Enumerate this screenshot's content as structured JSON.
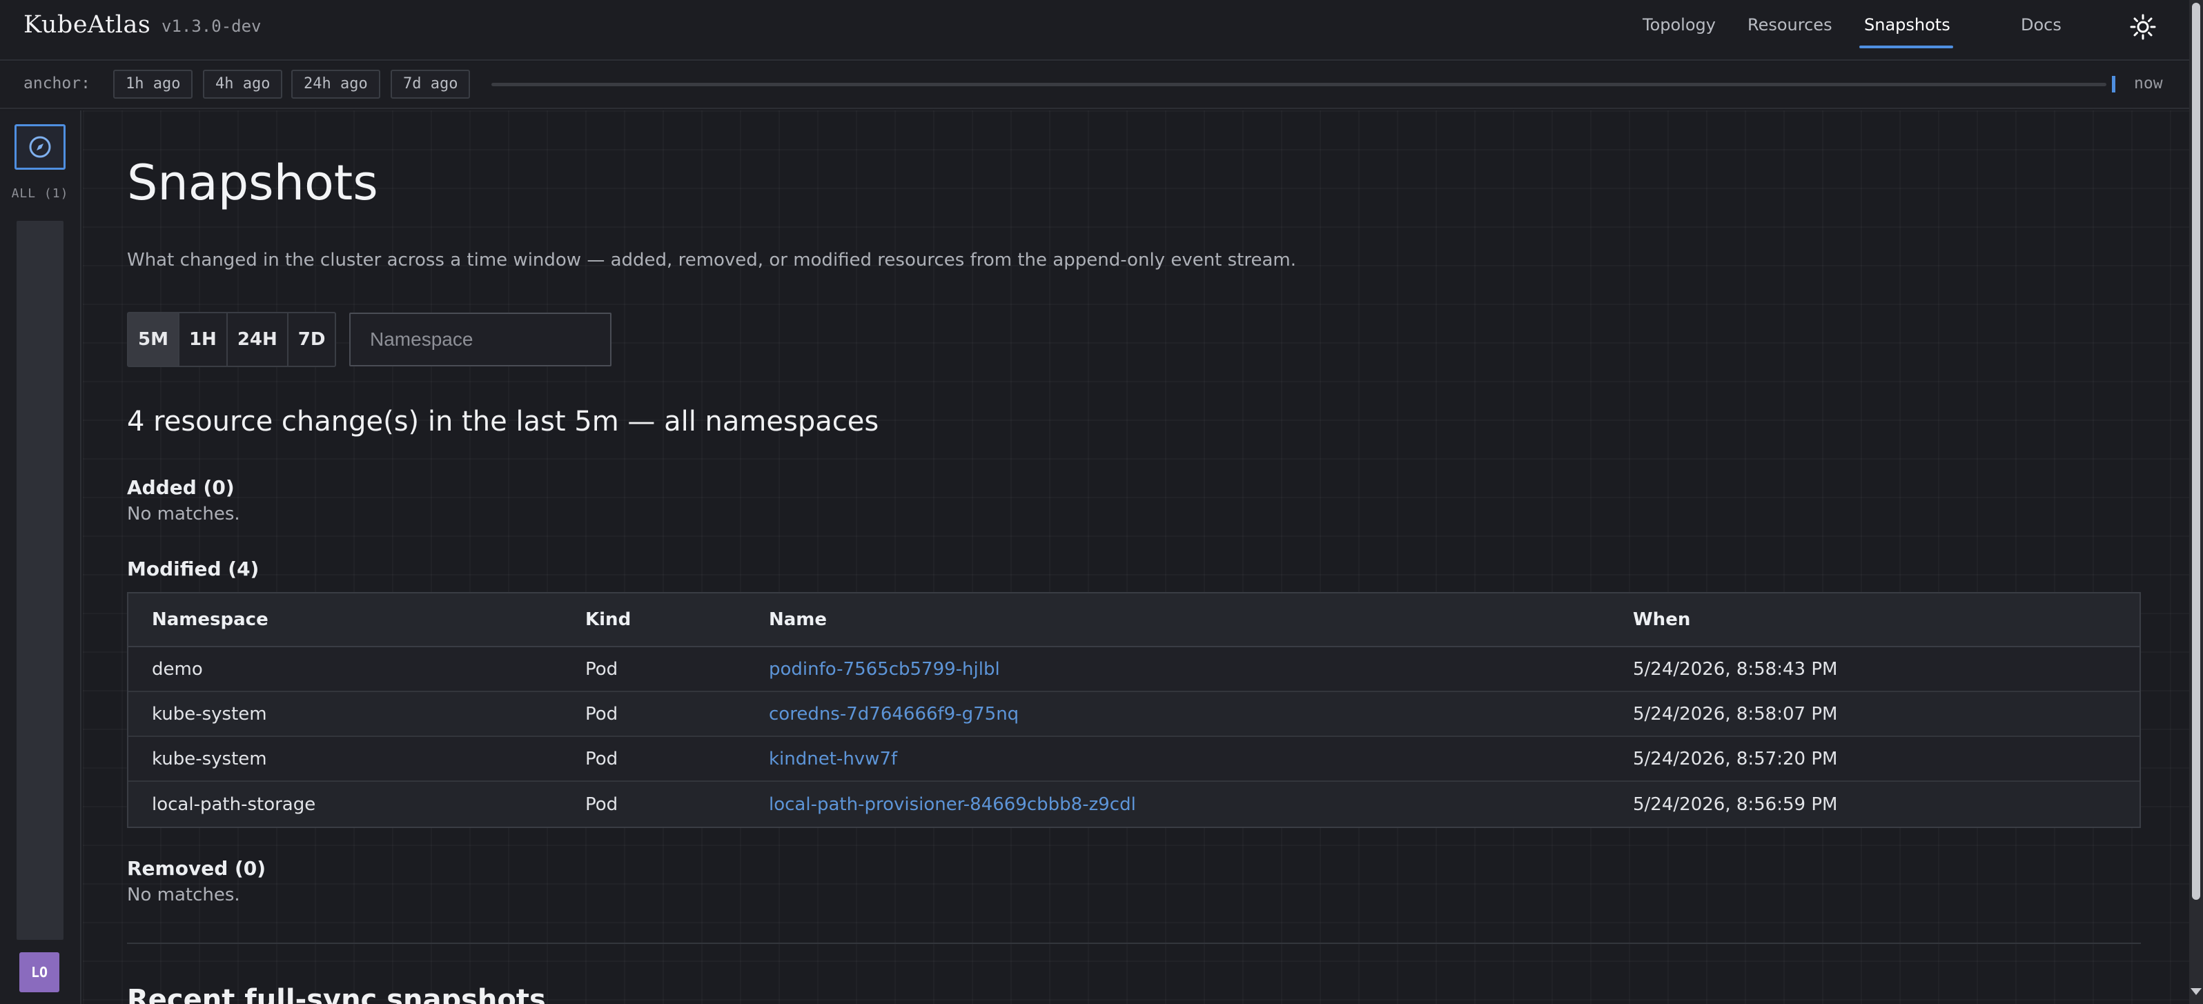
{
  "app": {
    "name": "KubeAtlas",
    "version": "v1.3.0-dev"
  },
  "nav": {
    "items": [
      {
        "label": "Topology",
        "active": false
      },
      {
        "label": "Resources",
        "active": false
      },
      {
        "label": "Snapshots",
        "active": true
      },
      {
        "label": "Docs",
        "active": false
      }
    ],
    "theme_icon": "sun-icon"
  },
  "anchor": {
    "label": "anchor:",
    "chips": [
      "1h ago",
      "4h ago",
      "24h ago",
      "7d ago"
    ],
    "now_label": "now"
  },
  "rail": {
    "compass_icon": "compass-icon",
    "all_label": "ALL (1)",
    "avatar_initials": "LO",
    "avatar_color": "#8a6bbe"
  },
  "page": {
    "title": "Snapshots",
    "description": "What changed in the cluster across a time window — added, removed, or modified resources from the append-only event stream.",
    "windows": [
      "5M",
      "1H",
      "24H",
      "7D"
    ],
    "active_window": "5M",
    "namespace_placeholder": "Namespace",
    "changes_heading": "4 resource change(s) in the last 5m — all namespaces"
  },
  "added": {
    "title": "Added (0)",
    "empty": "No matches."
  },
  "modified": {
    "title": "Modified (4)",
    "columns": [
      "Namespace",
      "Kind",
      "Name",
      "When"
    ],
    "rows": [
      {
        "namespace": "demo",
        "kind": "Pod",
        "name": "podinfo-7565cb5799-hjlbl",
        "when": "5/24/2026, 8:58:43 PM"
      },
      {
        "namespace": "kube-system",
        "kind": "Pod",
        "name": "coredns-7d764666f9-g75nq",
        "when": "5/24/2026, 8:58:07 PM"
      },
      {
        "namespace": "kube-system",
        "kind": "Pod",
        "name": "kindnet-hvw7f",
        "when": "5/24/2026, 8:57:20 PM"
      },
      {
        "namespace": "local-path-storage",
        "kind": "Pod",
        "name": "local-path-provisioner-84669cbbb8-z9cdl",
        "when": "5/24/2026, 8:56:59 PM"
      }
    ]
  },
  "removed": {
    "title": "Removed (0)",
    "empty": "No matches."
  },
  "recent": {
    "heading": "Recent full-sync snapshots"
  },
  "colors": {
    "accent": "#4f8fe0",
    "link": "#5d95d8",
    "background": "#1b1c21"
  }
}
